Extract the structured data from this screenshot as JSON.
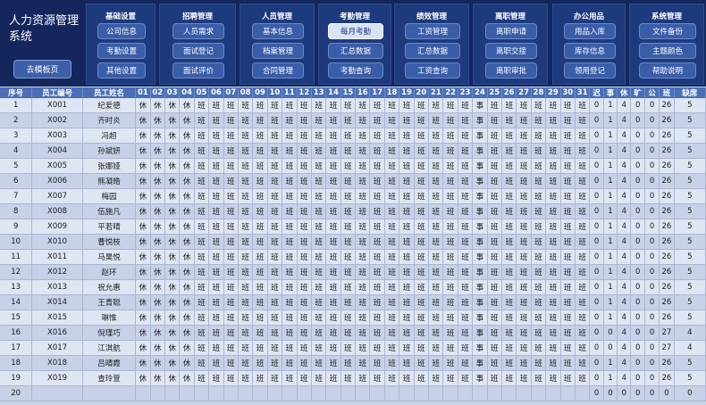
{
  "system": {
    "title_line1": "人力资源管理",
    "title_line2": "系统",
    "home_button": "去模板页"
  },
  "panels": [
    {
      "title": "基础设置",
      "buttons": [
        {
          "label": "公司信息",
          "active": false
        },
        {
          "label": "考勤设置",
          "active": false
        },
        {
          "label": "其他设置",
          "active": false
        }
      ]
    },
    {
      "title": "招聘管理",
      "buttons": [
        {
          "label": "人员需求",
          "active": false
        },
        {
          "label": "面试登记",
          "active": false
        },
        {
          "label": "面试评价",
          "active": false
        }
      ]
    },
    {
      "title": "人员管理",
      "buttons": [
        {
          "label": "基本信息",
          "active": false
        },
        {
          "label": "档案管理",
          "active": false
        },
        {
          "label": "合同管理",
          "active": false
        }
      ]
    },
    {
      "title": "考勤管理",
      "buttons": [
        {
          "label": "每月考勤",
          "active": true
        },
        {
          "label": "汇总数据",
          "active": false
        },
        {
          "label": "考勤查询",
          "active": false
        }
      ]
    },
    {
      "title": "绩效管理",
      "buttons": [
        {
          "label": "工资管理",
          "active": false
        },
        {
          "label": "汇总数据",
          "active": false
        },
        {
          "label": "工资查询",
          "active": false
        }
      ]
    },
    {
      "title": "离职管理",
      "buttons": [
        {
          "label": "离职申请",
          "active": false
        },
        {
          "label": "离职交接",
          "active": false
        },
        {
          "label": "离职审批",
          "active": false
        }
      ]
    },
    {
      "title": "办公用品",
      "buttons": [
        {
          "label": "用品入库",
          "active": false
        },
        {
          "label": "库存信息",
          "active": false
        },
        {
          "label": "领用登记",
          "active": false
        }
      ]
    },
    {
      "title": "系统管理",
      "buttons": [
        {
          "label": "文件备份",
          "active": false
        },
        {
          "label": "主题颜色",
          "active": false
        },
        {
          "label": "帮助说明",
          "active": false
        }
      ]
    }
  ],
  "table": {
    "headers": [
      "序号",
      "员工编号",
      "员工姓名",
      "01",
      "02",
      "03",
      "04",
      "05",
      "06",
      "07",
      "08",
      "09",
      "10",
      "11",
      "12",
      "13",
      "14",
      "15",
      "16",
      "17",
      "18",
      "19",
      "20",
      "21",
      "22",
      "23",
      "24",
      "25",
      "26",
      "27",
      "28",
      "29",
      "30",
      "31",
      "迟",
      "事",
      "休",
      "旷",
      "公",
      "班",
      "缺席"
    ],
    "day_pattern": [
      "休",
      "休",
      "休",
      "休",
      "班",
      "班",
      "班",
      "班",
      "班",
      "班",
      "班",
      "班",
      "班",
      "班",
      "班",
      "班",
      "班",
      "班",
      "班",
      "班",
      "班",
      "班",
      "班",
      "事",
      "班",
      "班",
      "班",
      "班",
      "班",
      "班",
      "班"
    ],
    "rows": [
      {
        "no": "1",
        "id": "X001",
        "name": "纪爱德",
        "late": "0",
        "leave": "1",
        "rest": "4",
        "absent": "0",
        "pub": "0",
        "work": "26",
        "miss": "5"
      },
      {
        "no": "2",
        "id": "X002",
        "name": "齐时炎",
        "late": "0",
        "leave": "1",
        "rest": "4",
        "absent": "0",
        "pub": "0",
        "work": "26",
        "miss": "5"
      },
      {
        "no": "3",
        "id": "X003",
        "name": "冯超",
        "late": "0",
        "leave": "1",
        "rest": "4",
        "absent": "0",
        "pub": "0",
        "work": "26",
        "miss": "5"
      },
      {
        "no": "4",
        "id": "X004",
        "name": "孙斌妍",
        "late": "0",
        "leave": "1",
        "rest": "4",
        "absent": "0",
        "pub": "0",
        "work": "26",
        "miss": "5"
      },
      {
        "no": "5",
        "id": "X005",
        "name": "张娜娅",
        "late": "0",
        "leave": "1",
        "rest": "4",
        "absent": "0",
        "pub": "0",
        "work": "26",
        "miss": "5"
      },
      {
        "no": "6",
        "id": "X006",
        "name": "熊凝皓",
        "late": "0",
        "leave": "1",
        "rest": "4",
        "absent": "0",
        "pub": "0",
        "work": "26",
        "miss": "5"
      },
      {
        "no": "7",
        "id": "X007",
        "name": "梅园",
        "late": "0",
        "leave": "1",
        "rest": "4",
        "absent": "0",
        "pub": "0",
        "work": "26",
        "miss": "5"
      },
      {
        "no": "8",
        "id": "X008",
        "name": "伍施凡",
        "late": "0",
        "leave": "1",
        "rest": "4",
        "absent": "0",
        "pub": "0",
        "work": "26",
        "miss": "5"
      },
      {
        "no": "9",
        "id": "X009",
        "name": "平若晴",
        "late": "0",
        "leave": "1",
        "rest": "4",
        "absent": "0",
        "pub": "0",
        "work": "26",
        "miss": "5"
      },
      {
        "no": "10",
        "id": "X010",
        "name": "曹悦枝",
        "late": "0",
        "leave": "1",
        "rest": "4",
        "absent": "0",
        "pub": "0",
        "work": "26",
        "miss": "5"
      },
      {
        "no": "11",
        "id": "X011",
        "name": "马昊悦",
        "late": "0",
        "leave": "1",
        "rest": "4",
        "absent": "0",
        "pub": "0",
        "work": "26",
        "miss": "5"
      },
      {
        "no": "12",
        "id": "X012",
        "name": "赵环",
        "late": "0",
        "leave": "1",
        "rest": "4",
        "absent": "0",
        "pub": "0",
        "work": "26",
        "miss": "5"
      },
      {
        "no": "13",
        "id": "X013",
        "name": "祝允惠",
        "late": "0",
        "leave": "1",
        "rest": "4",
        "absent": "0",
        "pub": "0",
        "work": "26",
        "miss": "5"
      },
      {
        "no": "14",
        "id": "X014",
        "name": "王青聪",
        "late": "0",
        "leave": "1",
        "rest": "4",
        "absent": "0",
        "pub": "0",
        "work": "26",
        "miss": "5"
      },
      {
        "no": "15",
        "id": "X015",
        "name": "琳惟",
        "late": "0",
        "leave": "1",
        "rest": "4",
        "absent": "0",
        "pub": "0",
        "work": "26",
        "miss": "5"
      },
      {
        "no": "16",
        "id": "X016",
        "name": "倪瑾巧",
        "late": "0",
        "leave": "0",
        "rest": "4",
        "absent": "0",
        "pub": "0",
        "work": "27",
        "miss": "4"
      },
      {
        "no": "17",
        "id": "X017",
        "name": "江淇航",
        "late": "0",
        "leave": "0",
        "rest": "4",
        "absent": "0",
        "pub": "0",
        "work": "27",
        "miss": "4"
      },
      {
        "no": "18",
        "id": "X018",
        "name": "吕晴霞",
        "late": "0",
        "leave": "1",
        "rest": "4",
        "absent": "0",
        "pub": "0",
        "work": "26",
        "miss": "5"
      },
      {
        "no": "19",
        "id": "X019",
        "name": "查玲萱",
        "late": "0",
        "leave": "1",
        "rest": "4",
        "absent": "0",
        "pub": "0",
        "work": "26",
        "miss": "5"
      },
      {
        "no": "20",
        "id": "",
        "name": "",
        "late": "0",
        "leave": "0",
        "rest": "0",
        "absent": "0",
        "pub": "0",
        "work": "0",
        "miss": "0"
      }
    ]
  }
}
